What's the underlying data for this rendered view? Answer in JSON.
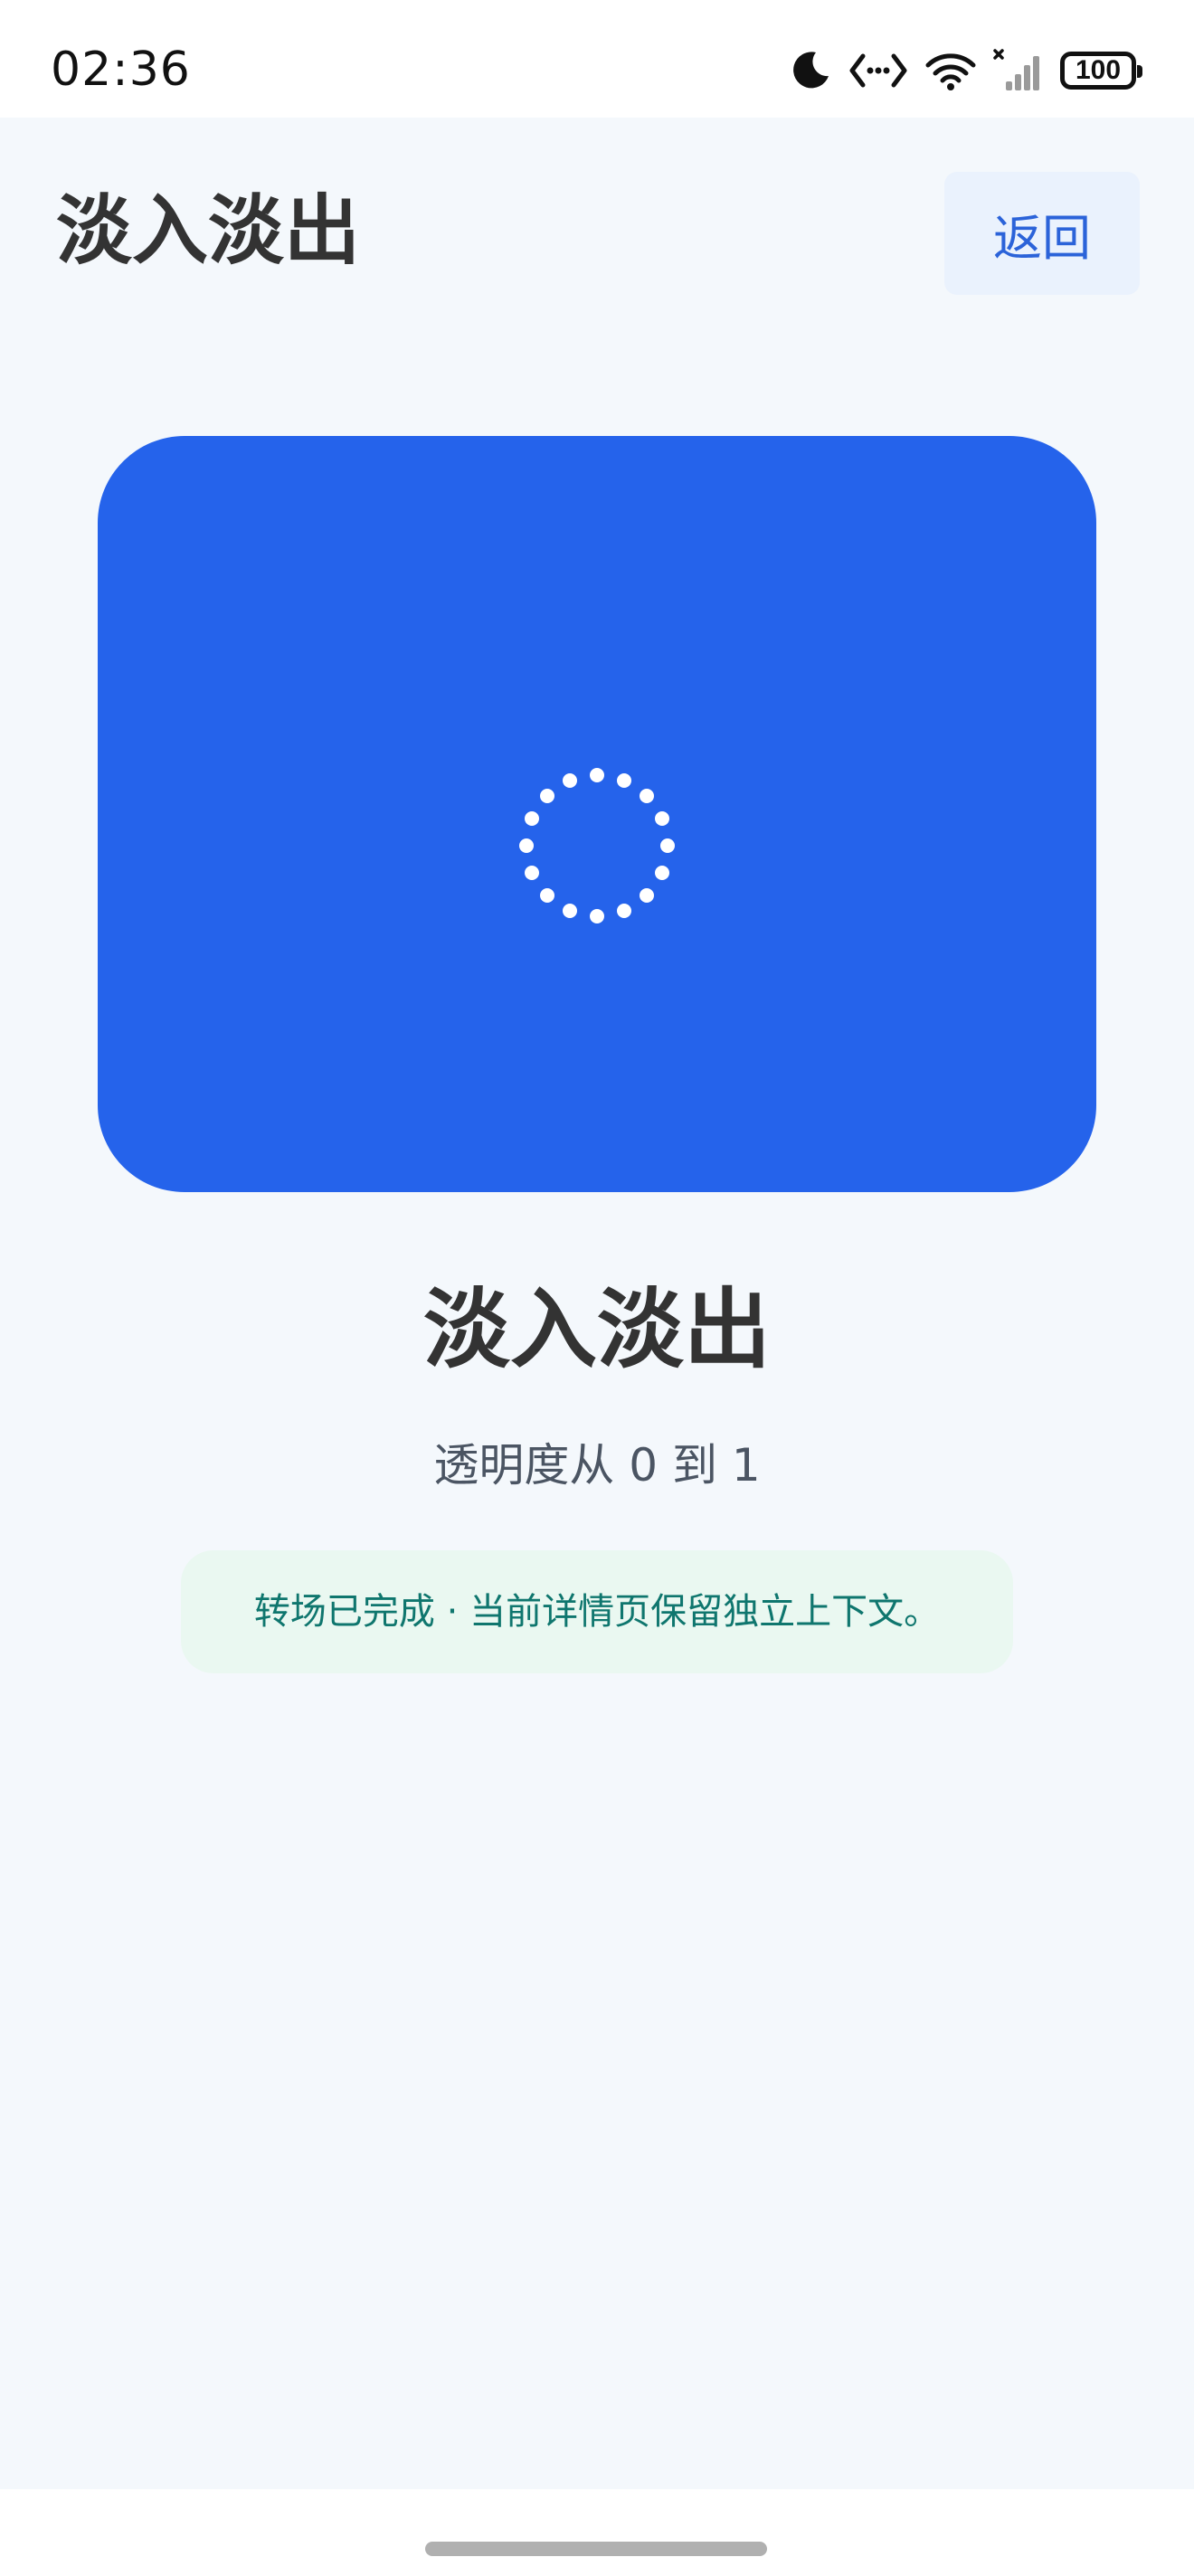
{
  "status_bar": {
    "time": "02:36",
    "battery": "100",
    "icons": [
      "moon-icon",
      "data-transfer-icon",
      "wifi-icon",
      "cellular-signal-icon",
      "battery-icon"
    ]
  },
  "header": {
    "title": "淡入淡出",
    "back_label": "返回"
  },
  "hero": {
    "color": "#2563eb",
    "icon": "loading-spinner-icon"
  },
  "detail": {
    "title": "淡入淡出",
    "subtitle": "透明度从 0 到 1",
    "status_message": "转场已完成 · 当前详情页保留独立上下文。"
  },
  "colors": {
    "accent": "#2563eb",
    "back_button_text": "#2b63d9",
    "back_button_bg": "#eaf2fd",
    "success_bg": "#eaf8f1",
    "success_text": "#0f766e",
    "background": "#f4f8fc"
  }
}
